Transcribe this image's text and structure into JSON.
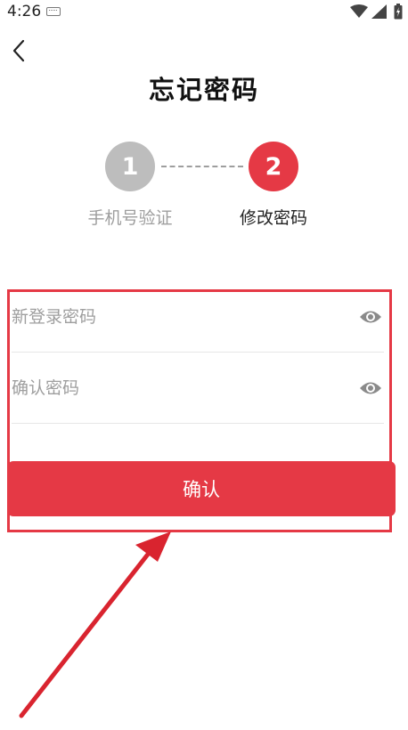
{
  "status_bar": {
    "time": "4:26",
    "icons": [
      "keyboard-icon",
      "wifi-icon",
      "signal-icon",
      "battery-icon"
    ]
  },
  "header": {
    "back_icon": "chevron-left-icon",
    "title": "忘记密码"
  },
  "steps": [
    {
      "number": "1",
      "label": "手机号验证",
      "active": false
    },
    {
      "number": "2",
      "label": "修改密码",
      "active": true
    }
  ],
  "form": {
    "new_password": {
      "value": "",
      "placeholder": "新登录密码",
      "toggle_icon": "eye-icon"
    },
    "confirm_password": {
      "value": "",
      "placeholder": "确认密码",
      "toggle_icon": "eye-icon"
    },
    "confirm_button": "确认"
  },
  "colors": {
    "accent": "#e53945",
    "inactive_step": "#bdbdbd",
    "muted_text": "#9e9e9e",
    "annotation": "#e53945"
  }
}
